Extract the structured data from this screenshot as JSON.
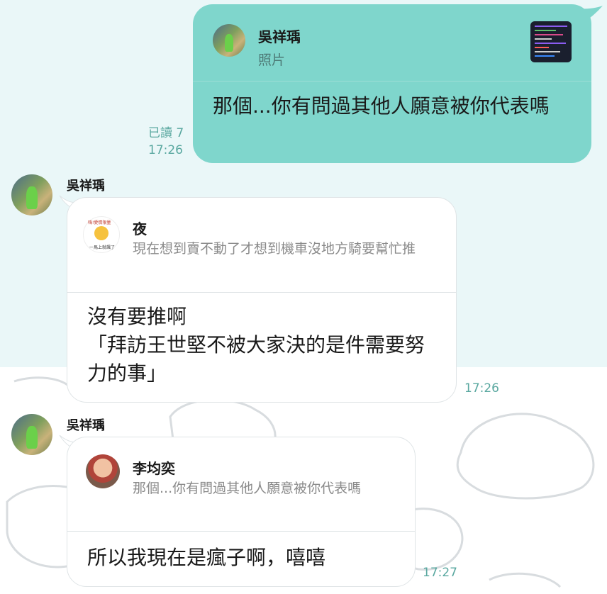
{
  "outgoing": {
    "reply": {
      "name": "吳祥瑀",
      "sub": "照片"
    },
    "text": "那個...你有問過其他人願意被你代表嗎",
    "read": "已讀 7",
    "time": "17:26"
  },
  "msg1": {
    "sender": "吳祥瑀",
    "reply": {
      "name": "夜",
      "sub": "現在想到賣不動了才想到機車沒地方騎要幫忙推",
      "sticker_top": "嗨!愛情限量",
      "sticker_bottom": "一馬上就飆了"
    },
    "text_line1": "沒有要推啊",
    "text_line2": "「拜訪王世堅不被大家決的是件需要努力的事」",
    "time": "17:26"
  },
  "msg2": {
    "sender": "吳祥瑀",
    "reply": {
      "name": "李均奕",
      "sub": "那個...你有問過其他人願意被你代表嗎"
    },
    "text": "所以我現在是瘋子啊，嘻嘻",
    "time": "17:27"
  },
  "colors": {
    "outgoing_bubble": "#7fd6cc",
    "timestamp": "#5aa8a0",
    "chat_bg_top": "#eaf7f8"
  }
}
